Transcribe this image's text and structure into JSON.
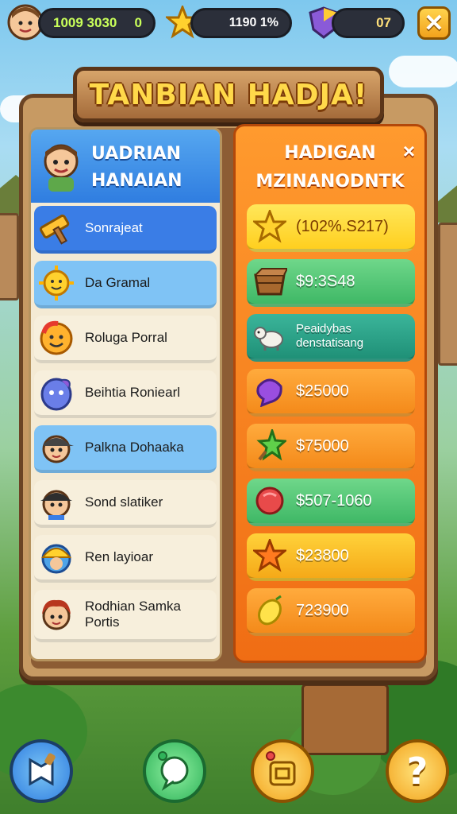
{
  "hud": {
    "coins_value": "1009 3030",
    "coins_suffix": "0",
    "stars_value": "1190 1%",
    "gems_value": "07"
  },
  "title": "TANBIAN HADJA!",
  "left_panel": {
    "header_line1": "UADRIAN",
    "header_line2": "HANAIAN",
    "rows": [
      {
        "label": "Sonrajeat",
        "style": "selected",
        "icon": "hammer-icon"
      },
      {
        "label": "Da Gramal",
        "style": "light",
        "icon": "sun-face-icon"
      },
      {
        "label": "Roluga Porral",
        "style": "plain",
        "icon": "smiley-icon"
      },
      {
        "label": "Beihtia Roniearl",
        "style": "plain",
        "icon": "blue-creature-icon"
      },
      {
        "label": "Palkna Dohaaka",
        "style": "light",
        "icon": "boy-cap-icon"
      },
      {
        "label": "Sond slatiker",
        "style": "plain",
        "icon": "boy-hat-icon"
      },
      {
        "label": "Ren layioar",
        "style": "plain",
        "icon": "helmet-icon"
      },
      {
        "label": "Rodhian Samka Portis",
        "style": "plain",
        "icon": "redhead-icon"
      }
    ]
  },
  "right_panel": {
    "header_line1": "HADIGAN",
    "header_line2": "MZINANODNTK",
    "close_symbol": "×",
    "items": [
      {
        "value": "(102%.S217)",
        "color": "yellow",
        "icon": "star-icon"
      },
      {
        "value": "$9:3S48",
        "color": "green",
        "icon": "crate-icon"
      },
      {
        "value": "Peaidybas\ndenstatisang",
        "color": "teal",
        "icon": "goat-icon"
      },
      {
        "value": "$25000",
        "color": "orange",
        "icon": "purple-gem-icon"
      },
      {
        "value": "$75000",
        "color": "orange",
        "icon": "green-star-icon"
      },
      {
        "value": "$507-1060",
        "color": "green",
        "icon": "red-gem-icon"
      },
      {
        "value": "$23800",
        "color": "gold",
        "icon": "orange-star-icon"
      },
      {
        "value": "723900",
        "color": "orange",
        "icon": "lemon-icon"
      }
    ]
  },
  "colors": {
    "accent_blue": "#3a7de6",
    "accent_orange": "#f06d14",
    "hud_text": "#c9ff5a",
    "title_gold": "#ffd94a"
  }
}
